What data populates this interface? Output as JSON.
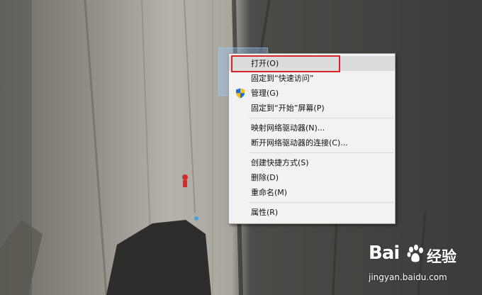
{
  "context_menu": {
    "items": [
      {
        "label": "打开(O)",
        "highlighted": true
      },
      {
        "label": "固定到“快速访问”"
      },
      {
        "label": "管理(G)",
        "icon": "shield-icon"
      },
      {
        "label": "固定到“开始”屏幕(P)"
      },
      {
        "label": "映射网络驱动器(N)..."
      },
      {
        "label": "断开网络驱动器的连接(C)..."
      },
      {
        "label": "创建快捷方式(S)"
      },
      {
        "label": "删除(D)"
      },
      {
        "label": "重命名(M)"
      },
      {
        "label": "属性(R)"
      }
    ]
  },
  "annotation": {
    "color": "#d8232a"
  },
  "watermark": {
    "logo": "Bai",
    "brand": "经验",
    "url": "jingyan.baidu.com"
  }
}
